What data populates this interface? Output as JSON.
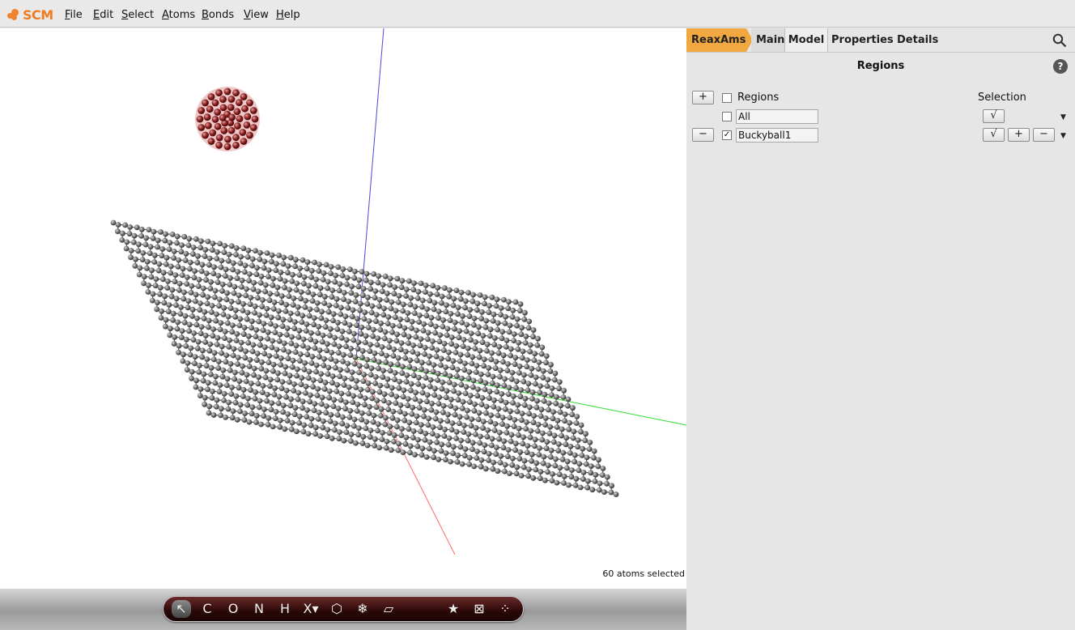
{
  "app": {
    "logo_text": "SCM",
    "brand_color": "#ef7b22"
  },
  "menu": [
    {
      "key": "F",
      "rest": "ile"
    },
    {
      "key": "E",
      "rest": "dit"
    },
    {
      "key": "S",
      "rest": "elect"
    },
    {
      "key": "A",
      "rest": "toms"
    },
    {
      "key": "B",
      "rest": "onds"
    },
    {
      "key": "V",
      "rest": "iew"
    },
    {
      "key": "H",
      "rest": "elp"
    }
  ],
  "viewport": {
    "status": "60 atoms selected",
    "axis_colors": {
      "x": "#ff6f61",
      "y": "#33dd33",
      "z": "#4a4adf"
    }
  },
  "toolbar": {
    "tools": [
      {
        "name": "select-tool",
        "glyph": "↖"
      },
      {
        "name": "carbon-tool",
        "glyph": "C"
      },
      {
        "name": "oxygen-tool",
        "glyph": "O"
      },
      {
        "name": "nitrogen-tool",
        "glyph": "N"
      },
      {
        "name": "hydrogen-tool",
        "glyph": "H"
      },
      {
        "name": "other-element-tool",
        "glyph": "X▾"
      },
      {
        "name": "ring-tool",
        "glyph": "⬡"
      },
      {
        "name": "structure-tool",
        "glyph": "❄"
      },
      {
        "name": "crystal-tool",
        "glyph": "▱"
      },
      {
        "name": "favorites-tool",
        "glyph": "★"
      },
      {
        "name": "box-tool",
        "glyph": "⊠"
      },
      {
        "name": "cleanup-tool",
        "glyph": "⁘"
      }
    ]
  },
  "panel": {
    "tabs": {
      "engine": "ReaxAms",
      "main": "Main",
      "model": "Model",
      "properties": "Properties",
      "details": "Details"
    },
    "title": "Regions",
    "help": "?",
    "header_label": "Regions",
    "selection_label": "Selection",
    "add_glyph": "+",
    "remove_glyph": "−",
    "rows": [
      {
        "name": "All",
        "checked": false
      },
      {
        "name": "Buckyball1",
        "checked": true
      }
    ],
    "check_glyph": "√",
    "dropdown_glyph": "▼"
  }
}
